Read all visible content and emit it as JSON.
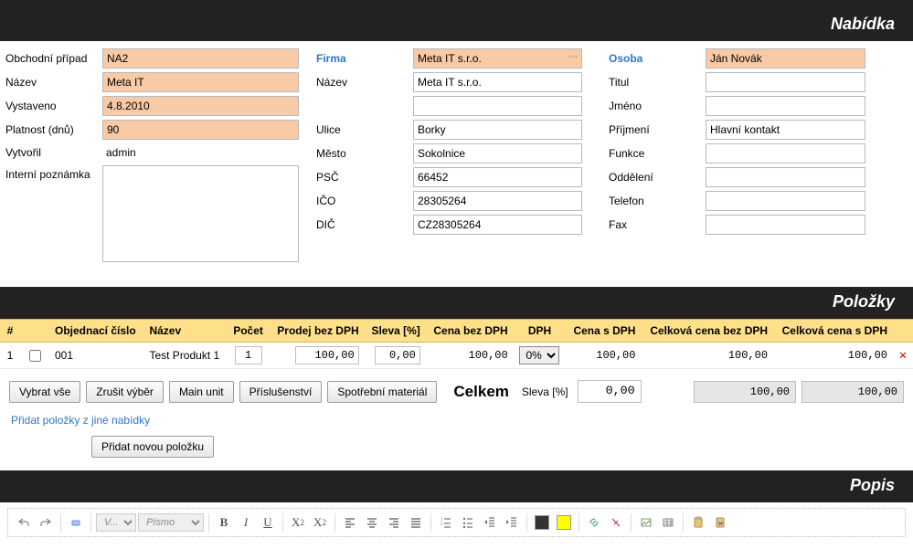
{
  "sections": {
    "offer": "Nabídka",
    "items": "Položky",
    "description": "Popis"
  },
  "left": {
    "case_label": "Obchodní případ",
    "case_value": "NA2",
    "name_label": "Název",
    "name_value": "Meta IT",
    "issued_label": "Vystaveno",
    "issued_value": "4.8.2010",
    "validity_label": "Platnost (dnů)",
    "validity_value": "90",
    "created_label": "Vytvořil",
    "created_value": "admin",
    "note_label": "Interní poznámka",
    "note_value": ""
  },
  "mid": {
    "firm_label": "Firma",
    "firm_value": "Meta IT s.r.o.",
    "name_label": "Název",
    "name_value": "Meta IT s.r.o.",
    "blank_value": "",
    "street_label": "Ulice",
    "street_value": "Borky",
    "city_label": "Město",
    "city_value": "Sokolnice",
    "zip_label": "PSČ",
    "zip_value": "66452",
    "ico_label": "IČO",
    "ico_value": "28305264",
    "dic_label": "DIČ",
    "dic_value": "CZ28305264"
  },
  "right": {
    "person_label": "Osoba",
    "person_value": "Ján Novák",
    "title_label": "Titul",
    "title_value": "",
    "first_label": "Jméno",
    "first_value": "",
    "last_label": "Příjmení",
    "last_value": "Hlavní kontakt",
    "role_label": "Funkce",
    "role_value": "",
    "dept_label": "Oddělení",
    "dept_value": "",
    "phone_label": "Telefon",
    "phone_value": "",
    "fax_label": "Fax",
    "fax_value": ""
  },
  "items": {
    "headers": {
      "num": "#",
      "order": "Objednací číslo",
      "name": "Název",
      "qty": "Počet",
      "sell": "Prodej bez DPH",
      "disc": "Sleva [%]",
      "price": "Cena bez DPH",
      "vat": "DPH",
      "pricevat": "Cena s DPH",
      "total": "Celková cena bez DPH",
      "totalvat": "Celková cena s DPH"
    },
    "rows": [
      {
        "num": "1",
        "order": "001",
        "name": "Test Produkt 1",
        "qty": "1",
        "sell": "100,00",
        "disc": "0,00",
        "price": "100,00",
        "vat": "0%",
        "pricevat": "100,00",
        "total": "100,00",
        "totalvat": "100,00"
      }
    ],
    "buttons": {
      "select_all": "Vybrat vše",
      "deselect": "Zrušit výběr",
      "main_unit": "Main unit",
      "accessories": "Příslušenství",
      "consumables": "Spotřební materiál"
    },
    "totals_label": "Celkem",
    "discount_label": "Sleva [%]",
    "discount_value": "0,00",
    "total1": "100,00",
    "total2": "100,00",
    "link_copy": "Přidat položky z jiné nabídky",
    "add_row": "Přidat novou položku"
  },
  "rte": {
    "placeholder_v": "V...",
    "placeholder_font": "Písmo"
  }
}
